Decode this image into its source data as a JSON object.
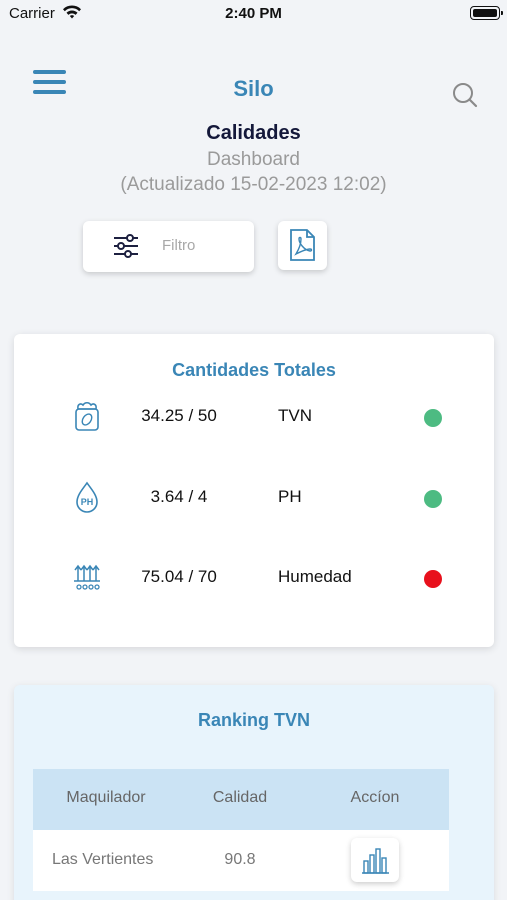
{
  "status_bar": {
    "carrier": "Carrier",
    "time": "2:40 PM"
  },
  "header": {
    "app_title": "Silo"
  },
  "page": {
    "title": "Calidades",
    "subtitle": "Dashboard",
    "updated": "(Actualizado 15-02-2023 12:02)"
  },
  "toolbar": {
    "filter_label": "Filtro"
  },
  "totals": {
    "title": "Cantidades Totales",
    "rows": [
      {
        "icon": "grain-bag-icon",
        "value": "34.25 / 50",
        "name": "TVN",
        "status_color": "#4dbb82"
      },
      {
        "icon": "ph-drop-icon",
        "value": "3.64 / 4",
        "name": "PH",
        "status_color": "#4dbb82"
      },
      {
        "icon": "humidity-icon",
        "value": "75.04 / 70",
        "name": "Humedad",
        "status_color": "#e8101c"
      }
    ]
  },
  "ranking": {
    "title": "Ranking TVN",
    "columns": [
      "Maquilador",
      "Calidad",
      "Accíon"
    ],
    "rows": [
      {
        "maquilador": "Las Vertientes",
        "calidad": "90.8"
      }
    ]
  },
  "colors": {
    "accent": "#3a86b6",
    "ok": "#4dbb82",
    "alert": "#e8101c"
  }
}
